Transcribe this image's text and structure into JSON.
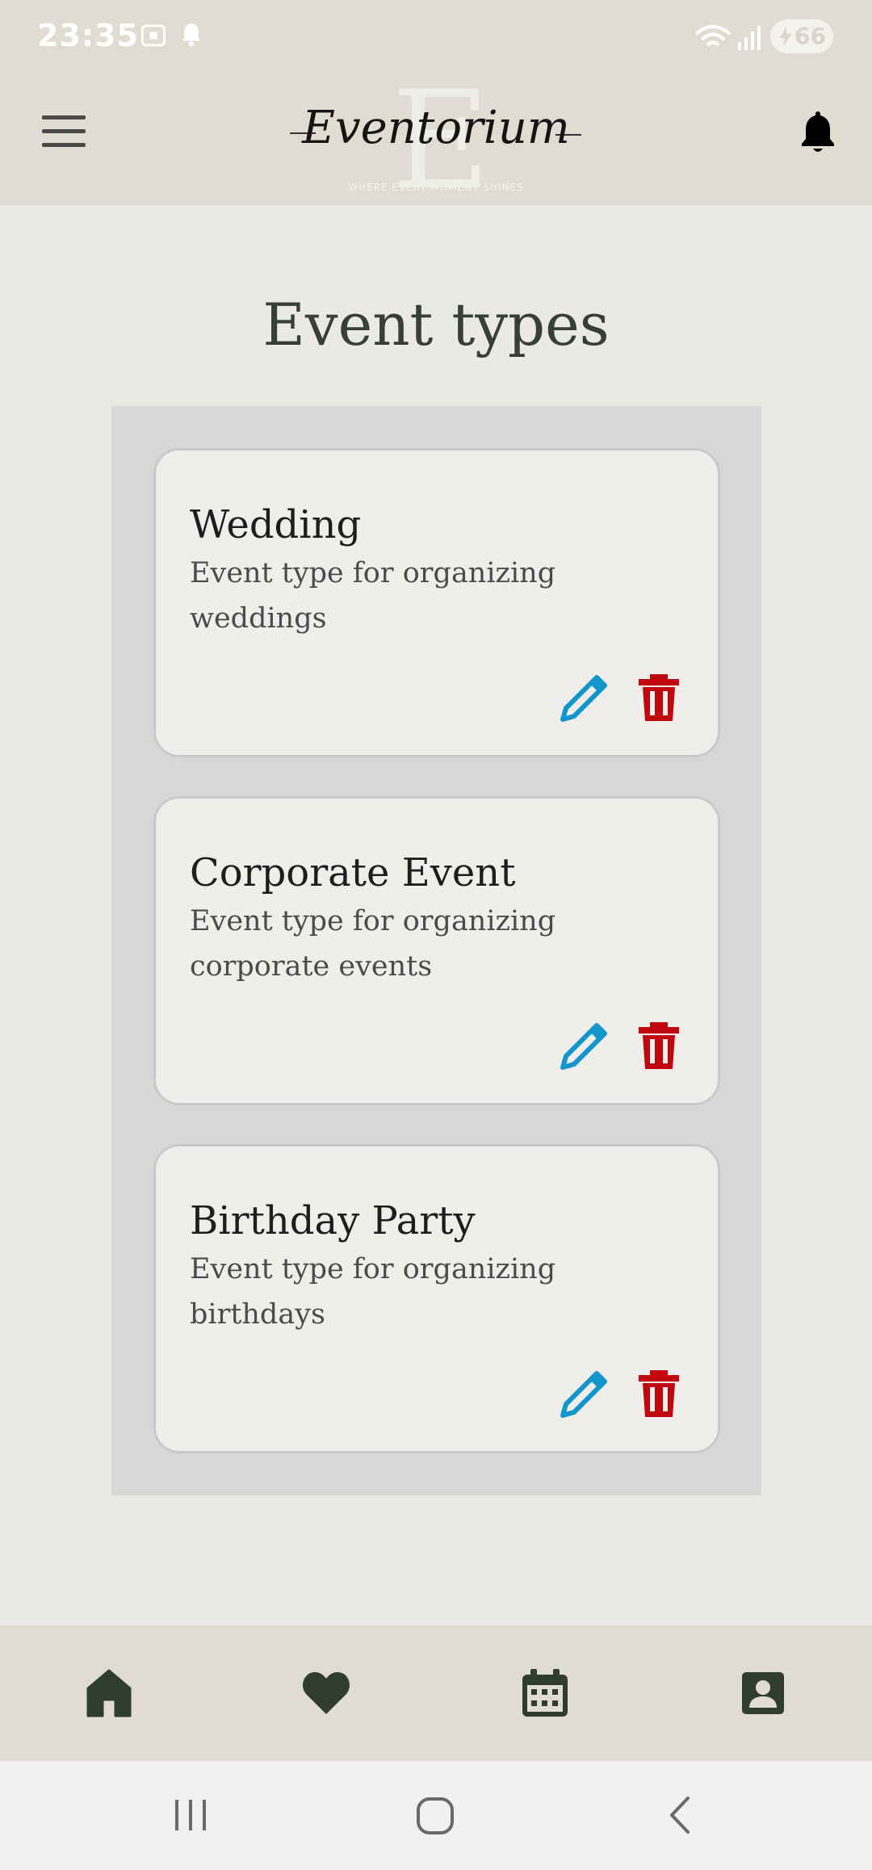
{
  "status_bar": {
    "time": "23:35",
    "battery_level": "66",
    "icons": [
      "screenshot-icon",
      "notification-bell-icon",
      "wifi-icon",
      "signal-icon",
      "battery-charging-icon"
    ]
  },
  "header": {
    "logo_text": "Eventorium",
    "logo_monogram": "E",
    "logo_tagline": "WHERE EVERY MOMENT SHINES",
    "icons": [
      "menu-icon",
      "bell-icon"
    ]
  },
  "page": {
    "title": "Event types"
  },
  "event_types": [
    {
      "name": "Wedding",
      "description": "Event type for organizing weddings"
    },
    {
      "name": "Corporate Event",
      "description": "Event type for organizing corporate events"
    },
    {
      "name": "Birthday Party",
      "description": "Event type for organizing birthdays"
    }
  ],
  "card_icons": [
    "pencil-icon",
    "trash-icon"
  ],
  "bottom_nav": [
    "home-icon",
    "heart-icon",
    "calendar-icon",
    "contact-card-icon"
  ],
  "system_nav": [
    "recents-icon",
    "home-circle-icon",
    "back-icon"
  ],
  "colors": {
    "header_bg": "#E0DCD2",
    "page_bg": "#EBE9E5",
    "title": "#364033",
    "edit": "#1296CC",
    "delete": "#C2060F",
    "nav_icon": "#2F3D2C"
  }
}
